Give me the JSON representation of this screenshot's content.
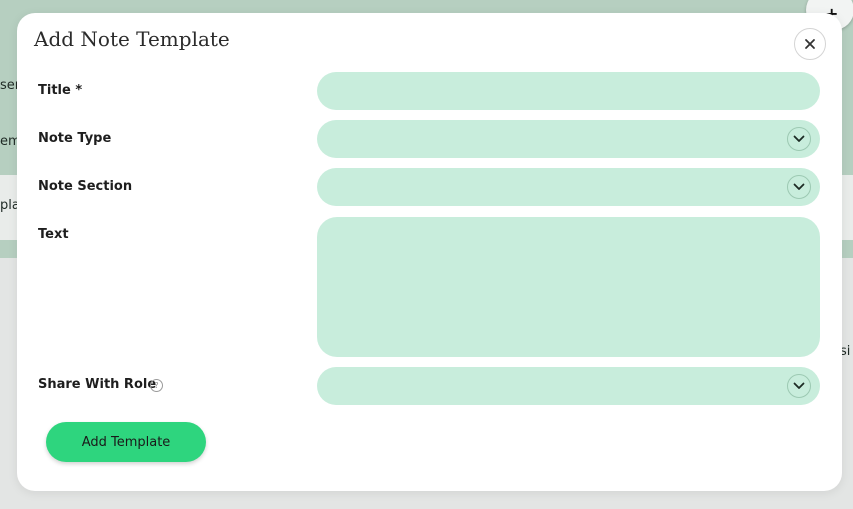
{
  "background": {
    "left_fragments": [
      "ser",
      "em",
      "pla"
    ],
    "right_fragment": "si",
    "fab_icon": "add-note-icon"
  },
  "modal": {
    "title": "Add Note Template",
    "close_icon": "close-icon",
    "fields": {
      "title": {
        "label": "Title *",
        "value": ""
      },
      "note_type": {
        "label": "Note Type",
        "value": ""
      },
      "note_section": {
        "label": "Note Section",
        "value": ""
      },
      "text": {
        "label": "Text",
        "value": ""
      },
      "share_with_role": {
        "label": "Share With Role",
        "value": "",
        "help_icon": "help-icon"
      }
    },
    "submit_label": "Add Template"
  },
  "colors": {
    "field_bg": "#c8eddc",
    "button_bg": "#2ed57e",
    "backdrop": "#b6cfc0"
  }
}
